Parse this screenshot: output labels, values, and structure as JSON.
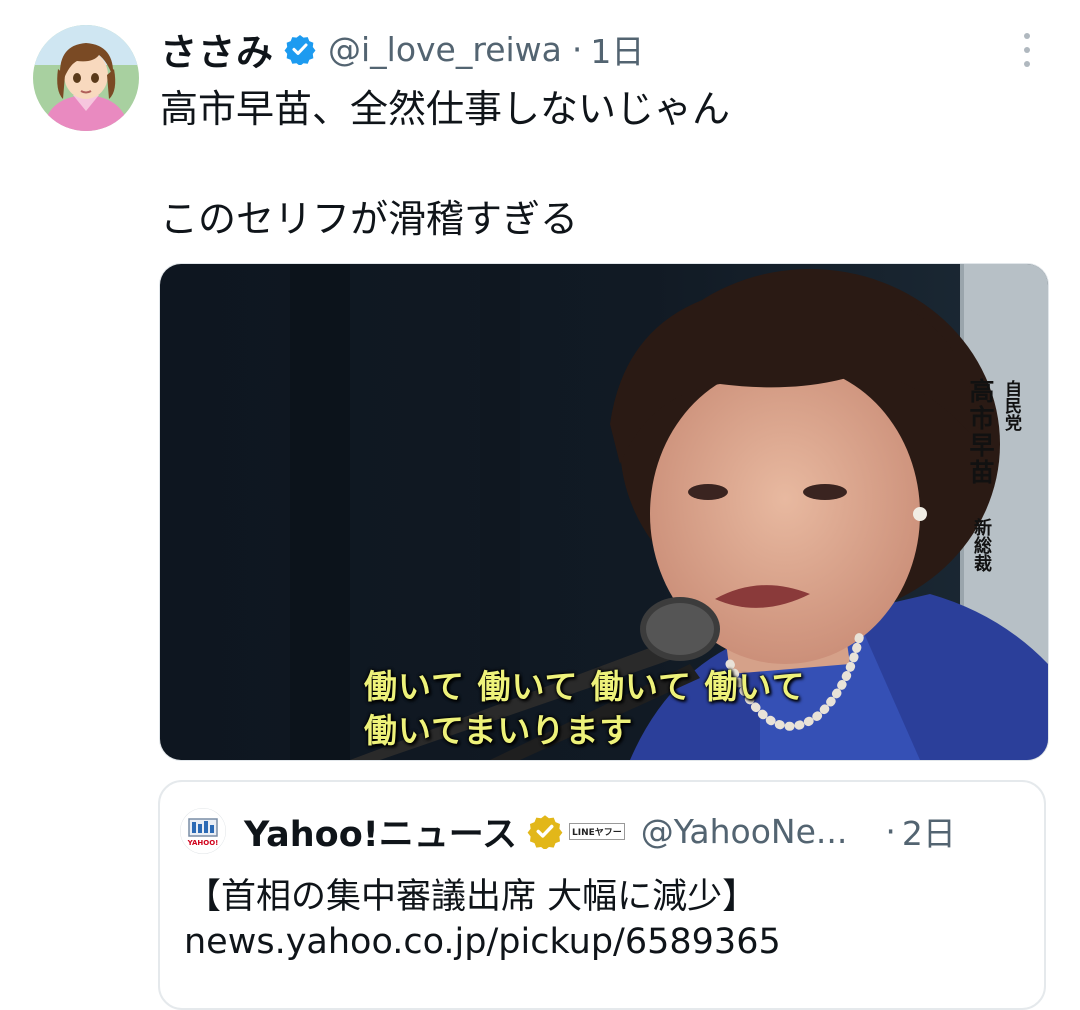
{
  "tweet": {
    "display_name": "ささみ",
    "handle": "@i_love_reiwa",
    "separator": "·",
    "time": "1日",
    "text": "高市早苗、全然仕事しないじゃん\n\nこのセリフが滑稽すぎる",
    "avatar_icon": "anime-girl-pink-hoodie-avatar",
    "verified_icon": "verified-badge-icon",
    "more_icon": "more-vertical-icon"
  },
  "media": {
    "subtitle_line1": "働いて 働いて 働いて 働いて",
    "subtitle_line2": "働いてまいります",
    "caption_party": "自民党",
    "caption_name": "高市早苗",
    "caption_title": "新総裁"
  },
  "quote": {
    "display_name": "Yahoo!ニュース",
    "affiliate_label": "LINEヤフー",
    "handle": "@YahooNe...",
    "separator": "·",
    "time": "2日",
    "title": "【首相の集中審議出席 大幅に減少】",
    "link": "news.yahoo.co.jp/pickup/6589365",
    "avatar_icon": "yahoo-news-logo-icon",
    "verified_icon": "gold-verified-badge-icon"
  },
  "colors": {
    "text": "#0f1419",
    "secondary": "#536471",
    "verified_blue": "#1d9bf0",
    "verified_gold": "#e2b719",
    "subtitle_yellow": "#eef27a"
  }
}
